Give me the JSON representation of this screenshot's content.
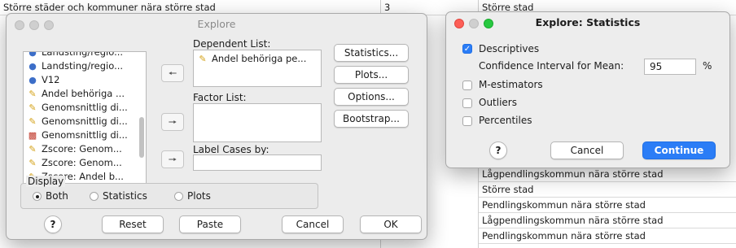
{
  "background_table": {
    "top_row": {
      "col1": "Större städer och kommuner nära större stad",
      "col2": "3",
      "col3": "Större stad"
    },
    "right_rows": [
      "Lågpendlingskommun nära större stad",
      "Större stad",
      "Pendlingskommun nära större stad",
      "Lågpendlingskommun nära större stad",
      "Pendlingskommun nära större stad"
    ]
  },
  "explore": {
    "title": "Explore",
    "variables": [
      {
        "icon": "nominal-icon",
        "label": "Landsting/regio..."
      },
      {
        "icon": "nominal-icon",
        "label": "V12"
      },
      {
        "icon": "scale-icon",
        "label": "Andel behöriga ..."
      },
      {
        "icon": "scale-icon",
        "label": "Genomsnittlig di..."
      },
      {
        "icon": "scale-icon",
        "label": "Genomsnittlig di..."
      },
      {
        "icon": "ordinal-icon",
        "label": "Genomsnittlig di..."
      },
      {
        "icon": "scale-icon",
        "label": "Zscore:  Genom..."
      },
      {
        "icon": "scale-icon",
        "label": "Zscore:  Genom..."
      },
      {
        "icon": "scale-icon",
        "label": "Zscore:  Andel b..."
      }
    ],
    "dependent_list_label": "Dependent List:",
    "dependent_items": [
      {
        "icon": "scale-icon",
        "label": "Andel behöriga pe..."
      }
    ],
    "factor_list_label": "Factor List:",
    "label_cases_label": "Label Cases by:",
    "buttons": {
      "statistics": "Statistics...",
      "plots": "Plots...",
      "options": "Options...",
      "bootstrap": "Bootstrap..."
    },
    "display_label": "Display",
    "display_options": {
      "both": "Both",
      "statistics": "Statistics",
      "plots": "Plots"
    },
    "display_selected": "Both",
    "footer": {
      "help": "?",
      "reset": "Reset",
      "paste": "Paste",
      "cancel": "Cancel",
      "ok": "OK"
    }
  },
  "statistics": {
    "title": "Explore: Statistics",
    "descriptives_label": "Descriptives",
    "descriptives_checked": true,
    "ci_label": "Confidence Interval for Mean:",
    "ci_value": "95",
    "ci_unit": "%",
    "m_estimators_label": "M-estimators",
    "outliers_label": "Outliers",
    "percentiles_label": "Percentiles",
    "help": "?",
    "cancel": "Cancel",
    "continue": "Continue"
  },
  "colors": {
    "accent": "#2b7df6",
    "close": "#fd5f57",
    "minimize": "#febc2e",
    "zoom": "#28c840",
    "inactive": "#cfcfcf"
  }
}
